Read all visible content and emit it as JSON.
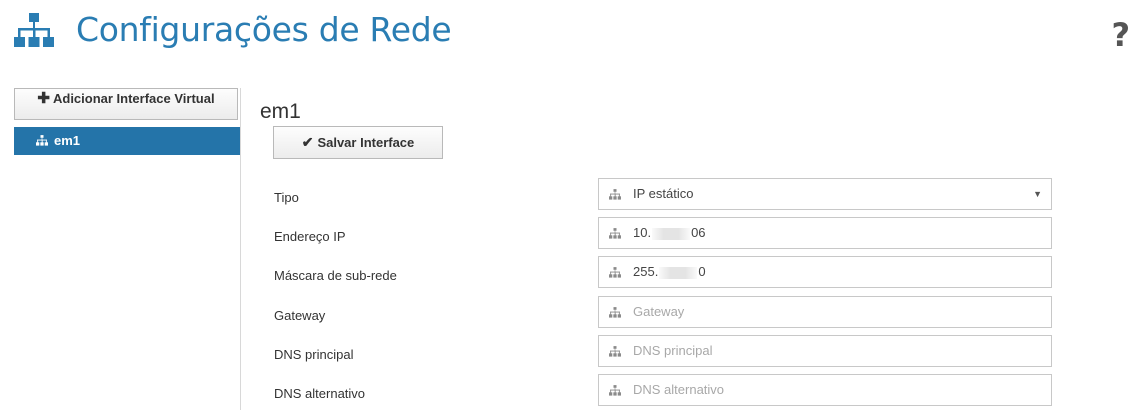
{
  "header": {
    "title": "Configurações de Rede",
    "help_label": "?",
    "icon": "network-icon"
  },
  "sidebar": {
    "add_button_label": "Adicionar Interface Virtual",
    "items": [
      {
        "label": "em1",
        "icon": "network-icon",
        "active": true
      }
    ]
  },
  "main": {
    "interface_name": "em1",
    "save_button_label": "Salvar Interface",
    "fields": [
      {
        "label": "Tipo",
        "type": "select",
        "value": "IP estático",
        "placeholder": ""
      },
      {
        "label": "Endereço IP",
        "type": "text",
        "value_prefix": "10.",
        "value_suffix": "06",
        "placeholder": ""
      },
      {
        "label": "Máscara de sub-rede",
        "type": "text",
        "value_prefix": "255.",
        "value_suffix": "0",
        "placeholder": ""
      },
      {
        "label": "Gateway",
        "type": "text",
        "value": "",
        "placeholder": "Gateway"
      },
      {
        "label": "DNS principal",
        "type": "text",
        "value": "",
        "placeholder": "DNS principal"
      },
      {
        "label": "DNS alternativo",
        "type": "text",
        "value": "",
        "placeholder": "DNS alternativo"
      }
    ]
  },
  "colors": {
    "accent": "#2a7db3",
    "active_nav": "#2474a9"
  }
}
